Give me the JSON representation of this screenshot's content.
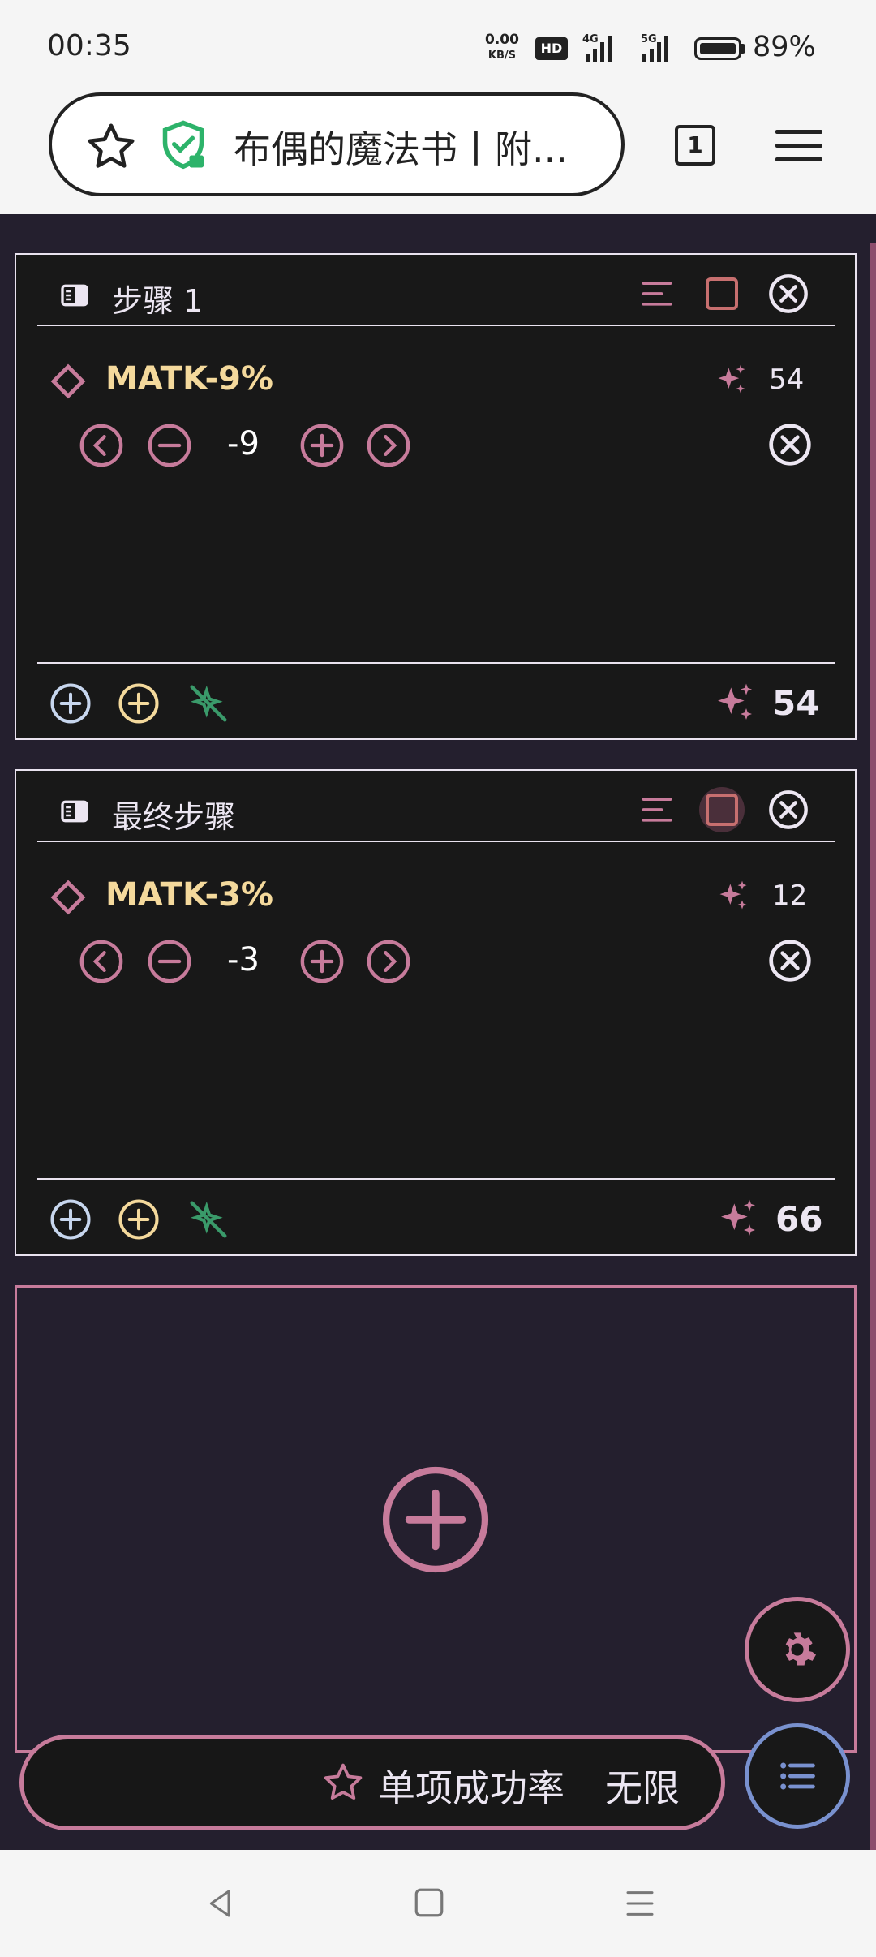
{
  "status_bar": {
    "time": "00:35",
    "net_speed": "0.00",
    "net_unit": "KB/S",
    "hd_label": "HD",
    "signal1_label": "4G",
    "signal2_label": "5G",
    "battery": "89%"
  },
  "browser": {
    "url_title": "布偶的魔法书丨附...",
    "tab_count": "1"
  },
  "cards": [
    {
      "title": "步骤 1",
      "effect": {
        "name": "MATK-9%",
        "points": "54",
        "value": "-9"
      },
      "footer_total": "54"
    },
    {
      "title": "最终步骤",
      "effect": {
        "name": "MATK-3%",
        "points": "12",
        "value": "-3"
      },
      "footer_total": "66"
    }
  ],
  "stat_bar": {
    "label": "单项成功率",
    "value": "无限"
  },
  "colors": {
    "accent_pink": "#c77b9b",
    "accent_yellow": "#f4d99c",
    "accent_blue": "#7991cf",
    "accent_green": "#3a9a6a",
    "background": "#241f2e",
    "card_bg": "#181818"
  }
}
